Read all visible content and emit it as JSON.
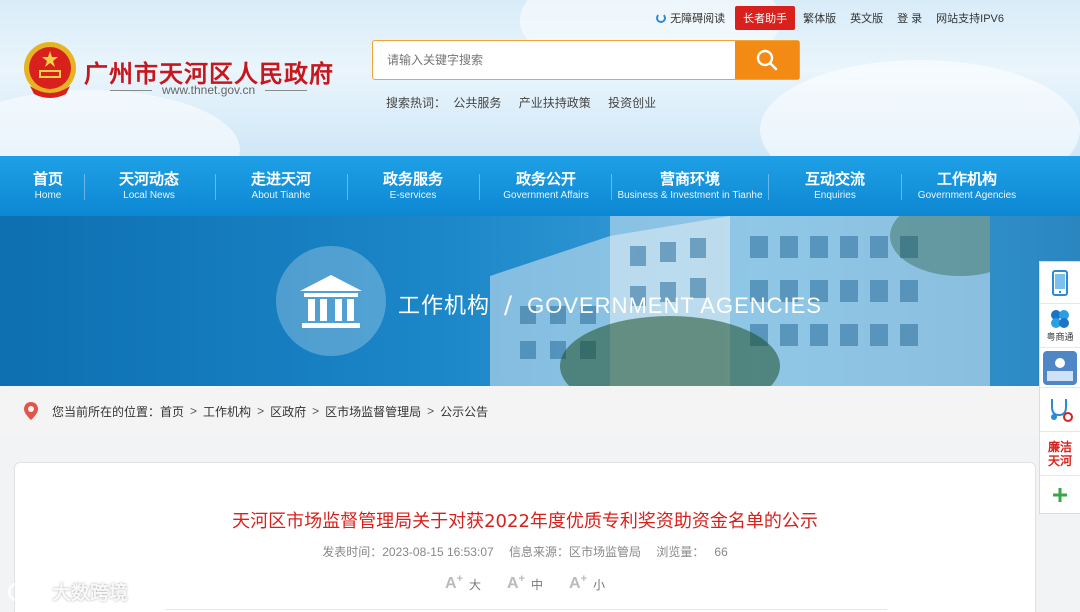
{
  "top_links": {
    "accessibility": "无障碍阅读",
    "elder_helper": "长者助手",
    "traditional": "繁体版",
    "english": "英文版",
    "login": "登 录",
    "ipv6": "网站支持IPV6"
  },
  "site": {
    "title": "广州市天河区人民政府",
    "url": "www.thnet.gov.cn"
  },
  "search": {
    "placeholder": "请输入关键字搜索",
    "hot_label": "搜索热词：",
    "hot_terms": [
      "公共服务",
      "产业扶持政策",
      "投资创业"
    ]
  },
  "nav": [
    {
      "cn": "首页",
      "en": "Home"
    },
    {
      "cn": "天河动态",
      "en": "Local News"
    },
    {
      "cn": "走进天河",
      "en": "About Tianhe"
    },
    {
      "cn": "政务服务",
      "en": "E-services"
    },
    {
      "cn": "政务公开",
      "en": "Government Affairs"
    },
    {
      "cn": "营商环境",
      "en": "Business & Investment in Tianhe"
    },
    {
      "cn": "互动交流",
      "en": "Enquiries"
    },
    {
      "cn": "工作机构",
      "en": "Government Agencies"
    }
  ],
  "banner": {
    "title_cn": "工作机构",
    "title_en": "GOVERNMENT AGENCIES"
  },
  "breadcrumb": {
    "label": "您当前所在的位置：",
    "items": [
      "首页",
      "工作机构",
      "区政府",
      "区市场监督管理局",
      "公示公告"
    ]
  },
  "article": {
    "title": "天河区市场监督管理局关于对获2022年度优质专利奖资助资金名单的公示",
    "publish_label": "发表时间：",
    "publish_time": "2023-08-15 16:53:07",
    "source_label": "信息来源：",
    "source": "区市场监管局",
    "views_label": "浏览量：",
    "views": "66",
    "font_sizes": [
      "大",
      "中",
      "小"
    ]
  },
  "float_bar": {
    "yueshangtong": "粤商通",
    "lianjie_1": "廉洁",
    "lianjie_2": "天河"
  },
  "watermark": "大数跨境",
  "colors": {
    "brand_red": "#d8211d",
    "nav_blue": "#0d87d2",
    "search_orange": "#f38a14"
  }
}
